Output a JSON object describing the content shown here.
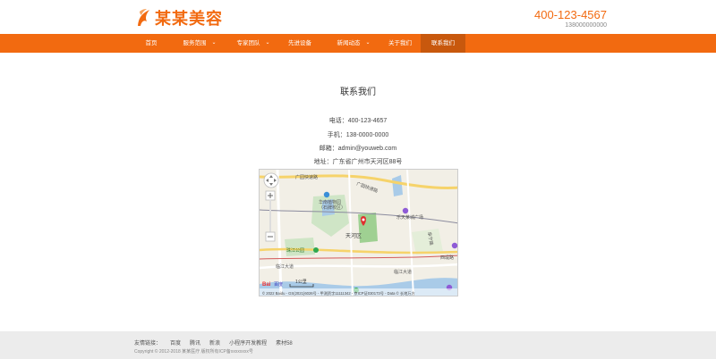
{
  "brand": {
    "name": "某某美容",
    "hotline": "400-123-4567",
    "mobile": "138000000000",
    "accent_color": "#f26a10"
  },
  "nav": {
    "items": [
      {
        "label": "首页",
        "dropdown": false,
        "active": false
      },
      {
        "label": "服务范围",
        "dropdown": true,
        "active": false
      },
      {
        "label": "专家团队",
        "dropdown": true,
        "active": false
      },
      {
        "label": "先进设备",
        "dropdown": false,
        "active": false
      },
      {
        "label": "新闻动态",
        "dropdown": true,
        "active": false
      },
      {
        "label": "关于我们",
        "dropdown": false,
        "active": false
      },
      {
        "label": "联系我们",
        "dropdown": false,
        "active": true
      }
    ],
    "caret": "⌄"
  },
  "contact": {
    "title": "联系我们",
    "phone": "电话：400-123-4657",
    "mobile": "手机：138-0000-0000",
    "email": "邮箱：admin@youweb.com",
    "address": "地址：广东省广州市天河区88号"
  },
  "map": {
    "labels": {
      "road1": "广园快速路",
      "road2": "广园快速路",
      "park1": "华南植物园",
      "park1b": "（石牌校区）",
      "district": "天河区",
      "plaza": "乐天某城广场",
      "park2": "珠江公园",
      "road3": "临江大道",
      "road4": "临江大道",
      "road5": "阜宁路",
      "sea": "西堤路",
      "brand": "Bai",
      "brand2": "百度",
      "scale": "1公里",
      "copyright": "© 2022 Baidu - GS(2021)6026号 - 甲测资字11111342 - 京ICP证030173号 - Data © 长地万方"
    }
  },
  "footer": {
    "links_label": "友情链接：",
    "links": [
      "百度",
      "腾讯",
      "新浪",
      "小程序开发教程",
      "素材58"
    ],
    "copyright": "Copyright © 2012-2018 某某医疗 版权所有ICP备xxxxxxxx号"
  }
}
